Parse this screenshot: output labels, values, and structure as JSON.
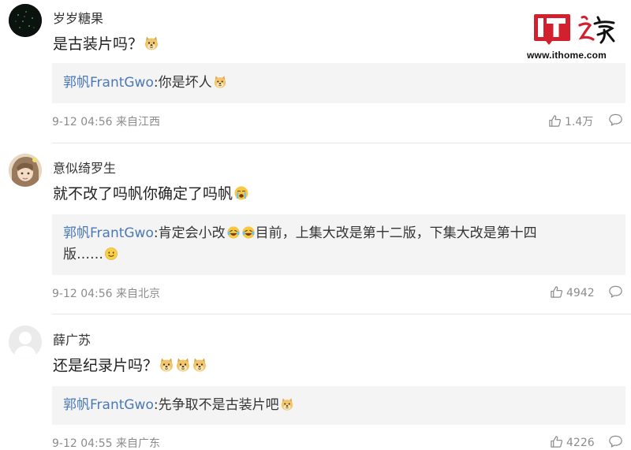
{
  "watermark": {
    "logo_text": "IT之家",
    "url": "www.ithome.com",
    "brand_color": "#d2202e"
  },
  "comments": [
    {
      "username": "岁岁糖果",
      "text": "是古装片吗？",
      "emojis": [
        "doge"
      ],
      "reply": {
        "author": "郭帆FrantGwo",
        "text": ":你是坏人",
        "emojis": [
          "doge"
        ]
      },
      "date": "9-12 04:56",
      "location": "来自江西",
      "likes": "1.4万",
      "icons": [
        "like-icon",
        "comment-icon"
      ]
    },
    {
      "username": "意似绮罗生",
      "text": "就不改了吗帆你确定了吗帆",
      "emojis": [
        "crying"
      ],
      "reply": {
        "author": "郭帆FrantGwo",
        "text_line1_before": ":肯定会小改",
        "text_line1_after": "目前，上集大改是第十二版，下集大改是第十四",
        "text_line2": "版……",
        "emojis": [
          "laugh-cry",
          "laugh-cry",
          "smile"
        ]
      },
      "date": "9-12 04:56",
      "location": "来自北京",
      "likes": "4942",
      "icons": [
        "like-icon",
        "comment-icon"
      ]
    },
    {
      "username": "薛广苏",
      "text": "还是纪录片吗？",
      "emojis": [
        "doge",
        "doge",
        "doge"
      ],
      "reply": {
        "author": "郭帆FrantGwo",
        "text": ":先争取不是古装片吧",
        "emojis": [
          "doge"
        ]
      },
      "date": "9-12 04:55",
      "location": "来自广东",
      "likes": "4226",
      "icons": [
        "like-icon",
        "comment-icon"
      ]
    }
  ]
}
